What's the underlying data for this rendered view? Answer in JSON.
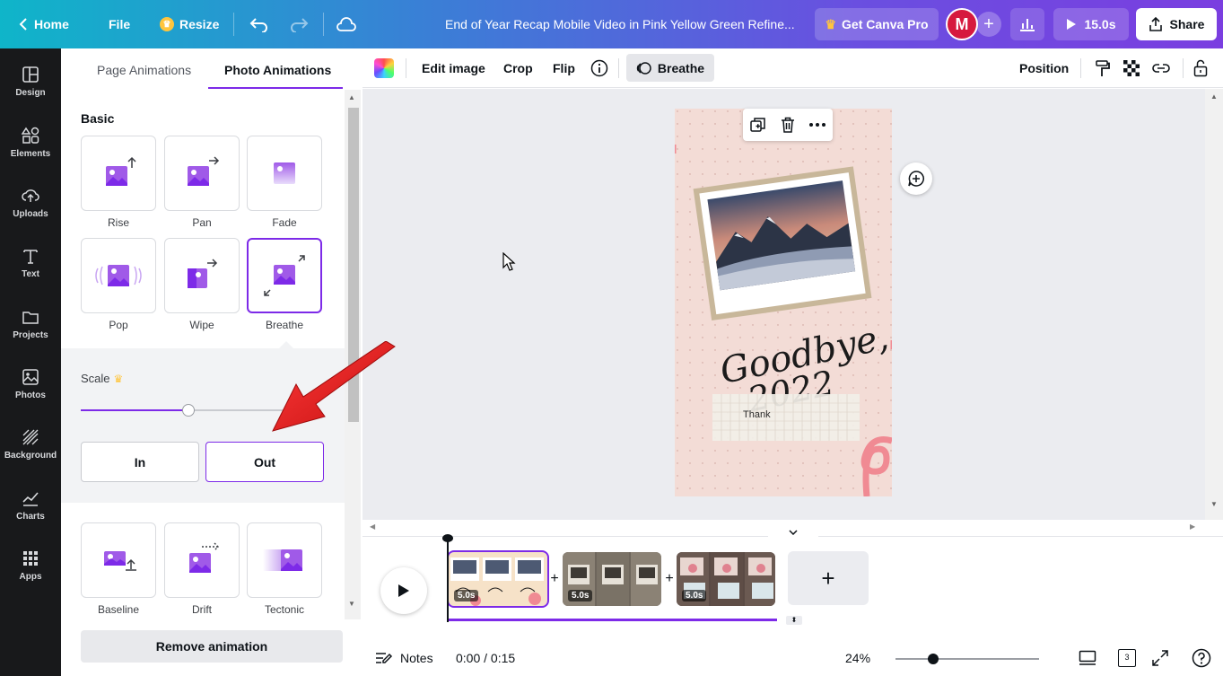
{
  "topbar": {
    "home": "Home",
    "file": "File",
    "resize": "Resize",
    "doc_title": "End of Year Recap Mobile Video in Pink Yellow Green Refine...",
    "get_pro": "Get Canva Pro",
    "avatar_initial": "M",
    "play_duration": "15.0s",
    "share": "Share",
    "crown_color": "#ffc53d"
  },
  "rail": {
    "items": [
      {
        "label": "Design",
        "icon": "design-icon"
      },
      {
        "label": "Elements",
        "icon": "elements-icon"
      },
      {
        "label": "Uploads",
        "icon": "uploads-icon"
      },
      {
        "label": "Text",
        "icon": "text-icon"
      },
      {
        "label": "Projects",
        "icon": "projects-icon"
      },
      {
        "label": "Photos",
        "icon": "photos-icon"
      },
      {
        "label": "Background",
        "icon": "background-icon"
      },
      {
        "label": "Charts",
        "icon": "charts-icon"
      },
      {
        "label": "Apps",
        "icon": "apps-icon"
      }
    ]
  },
  "panel": {
    "tabs": [
      "Page Animations",
      "Photo Animations"
    ],
    "active_tab": "Photo Animations",
    "section_basic": "Basic",
    "animations": [
      "Rise",
      "Pan",
      "Fade",
      "Pop",
      "Wipe",
      "Breathe",
      "Baseline",
      "Drift",
      "Tectonic"
    ],
    "selected_animation": "Breathe",
    "scale_label": "Scale",
    "scale_value": 0.52,
    "direction_in": "In",
    "direction_out": "Out",
    "selected_direction": "Out",
    "remove_animation": "Remove animation",
    "accent": "#7d2ae8"
  },
  "context_toolbar": {
    "edit_image": "Edit image",
    "crop": "Crop",
    "flip": "Flip",
    "animation_chip": "Breathe",
    "position": "Position"
  },
  "canvas": {
    "title_text_1": "Goodbye,",
    "title_text_2": "2022",
    "note_text": "Thank"
  },
  "timeline": {
    "clips": [
      {
        "duration": "5.0s",
        "selected": true
      },
      {
        "duration": "5.0s",
        "selected": false
      },
      {
        "duration": "5.0s",
        "selected": false
      }
    ]
  },
  "footer": {
    "notes": "Notes",
    "time": "0:00 / 0:15",
    "zoom": "24%",
    "page_count": "3"
  }
}
